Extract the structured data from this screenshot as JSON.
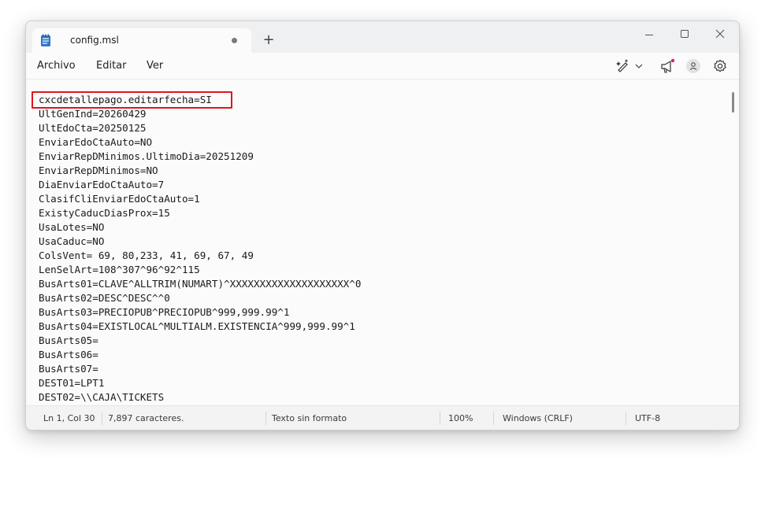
{
  "tab": {
    "title": "config.msl",
    "unsaved_indicator": "●",
    "new_tab_symbol": "+"
  },
  "menu": {
    "file": "Archivo",
    "edit": "Editar",
    "view": "Ver"
  },
  "toolbar_icons": [
    "copilot-rewrite-icon",
    "chevron-down-icon",
    "megaphone-icon",
    "account-icon",
    "settings-icon"
  ],
  "editor": {
    "lines": [
      "cxcdetallepago.editarfecha=SI",
      "UltGenInd=20260429",
      "UltEdoCta=20250125",
      "EnviarEdoCtaAuto=NO",
      "EnviarRepDMinimos.UltimoDia=20251209",
      "EnviarRepDMinimos=NO",
      "DiaEnviarEdoCtaAuto=7",
      "ClasifCliEnviarEdoCtaAuto=1",
      "ExistyCaducDiasProx=15",
      "UsaLotes=NO",
      "UsaCaduc=NO",
      "ColsVent= 69, 80,233, 41, 69, 67, 49",
      "LenSelArt=108^307^96^92^115",
      "BusArts01=CLAVE^ALLTRIM(NUMART)^XXXXXXXXXXXXXXXXXXXX^0",
      "BusArts02=DESC^DESC^^0",
      "BusArts03=PRECIOPUB^PRECIOPUB^999,999.99^1",
      "BusArts04=EXISTLOCAL^MULTIALM.EXISTENCIA^999,999.99^1",
      "BusArts05=",
      "BusArts06=",
      "BusArts07=",
      "DEST01=LPT1",
      "DEST02=\\\\CAJA\\TICKETS"
    ],
    "highlight_color": "#e0161b"
  },
  "status": {
    "position": "Ln 1, Col 30",
    "chars": "7,897 caracteres.",
    "format": "Texto sin formato",
    "zoom": "100%",
    "line_ending": "Windows (CRLF)",
    "encoding": "UTF-8"
  },
  "colors": {
    "notification_dot": "#d6246e",
    "titlebar": "#eef0f2"
  }
}
